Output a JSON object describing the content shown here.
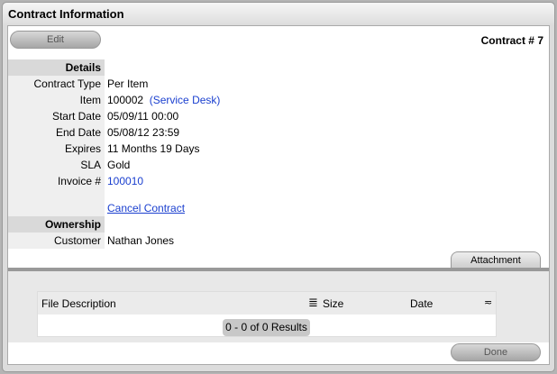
{
  "window": {
    "title": "Contract Information"
  },
  "toolbar": {
    "edit_label": "Edit",
    "contract_number": "Contract # 7"
  },
  "details": {
    "section": "Details",
    "rows": [
      {
        "label": "Contract Type",
        "value": "Per Item"
      },
      {
        "label": "Item",
        "value": "100002",
        "link": "(Service Desk)"
      },
      {
        "label": "Start Date",
        "value": "05/09/11 00:00"
      },
      {
        "label": "End Date",
        "value": "05/08/12 23:59"
      },
      {
        "label": "Expires",
        "value": "11 Months 19 Days"
      },
      {
        "label": "SLA",
        "value": "Gold"
      },
      {
        "label": "Invoice #",
        "link": "100010"
      }
    ],
    "cancel_link": "Cancel Contract"
  },
  "ownership": {
    "section": "Ownership",
    "customer_label": "Customer",
    "customer": "Nathan Jones"
  },
  "attachments": {
    "tab": "Attachment",
    "columns": [
      "File Description",
      "Size",
      "Date"
    ],
    "results": "0 - 0 of 0 Results"
  },
  "footer": {
    "done_label": "Done"
  }
}
